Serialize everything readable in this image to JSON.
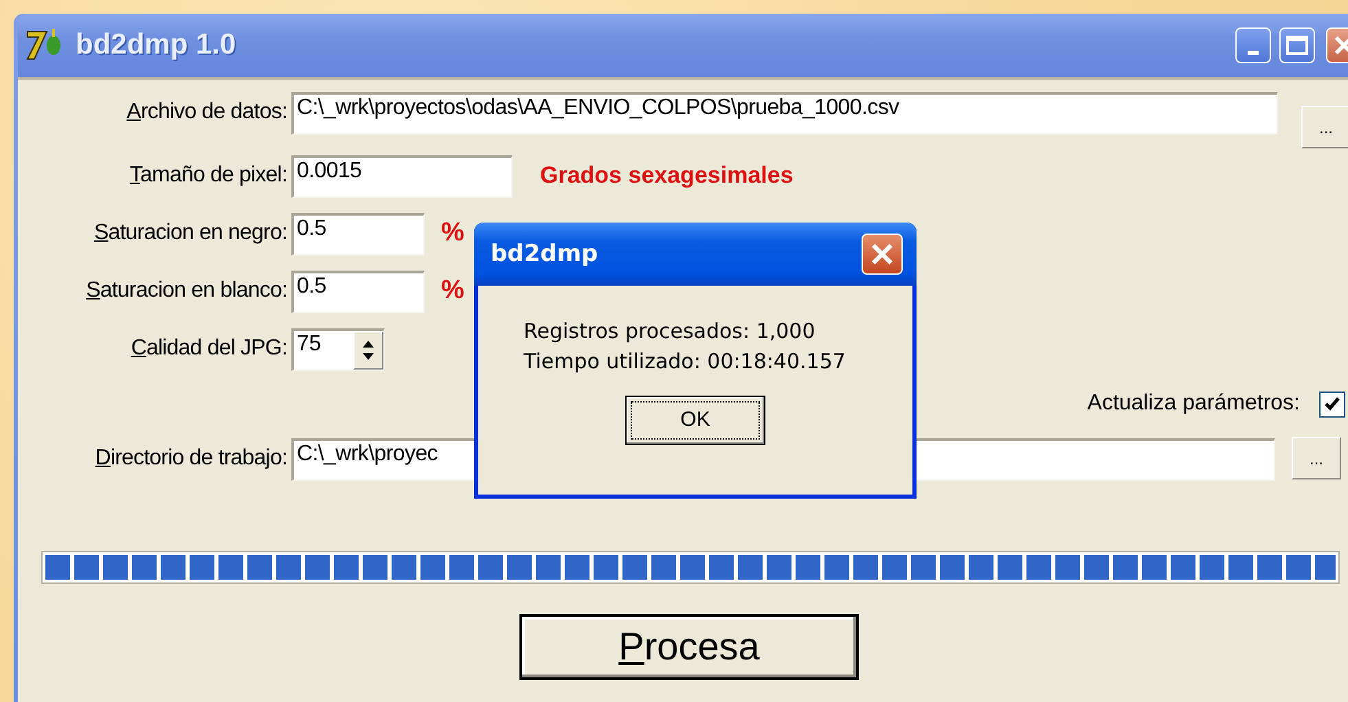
{
  "window": {
    "title": "bd2dmp 1.0"
  },
  "data_file": {
    "label": "Archivo de datos:",
    "value": "C:\\_wrk\\proyectos\\odas\\AA_ENVIO_COLPOS\\prueba_1000.csv",
    "browse_button": "..."
  },
  "pixel_size": {
    "label": "Tamaño de pixel:",
    "value": "0.0015",
    "note": "Grados sexagesimales"
  },
  "black_saturation": {
    "label": "Saturacion en negro:",
    "value": "0.5",
    "unit": "%"
  },
  "white_saturation": {
    "label": "Saturacion en blanco:",
    "value": "0.5",
    "unit": "%"
  },
  "jpg_quality": {
    "label": "Calidad del JPG:",
    "value": "75"
  },
  "update_params": {
    "label": "Actualiza parámetros:",
    "checked": true
  },
  "work_dir": {
    "label": "Directorio de trabajo:",
    "value": "C:\\_wrk\\proyec",
    "browse_button": "..."
  },
  "progress": {
    "level": 1
  },
  "process_button": "Procesa",
  "dialog": {
    "title": "bd2dmp",
    "lines": [
      "Registros procesados: 1,000",
      "Tiempo utilizado: 00:18:40.157"
    ],
    "ok_button": "OK"
  }
}
